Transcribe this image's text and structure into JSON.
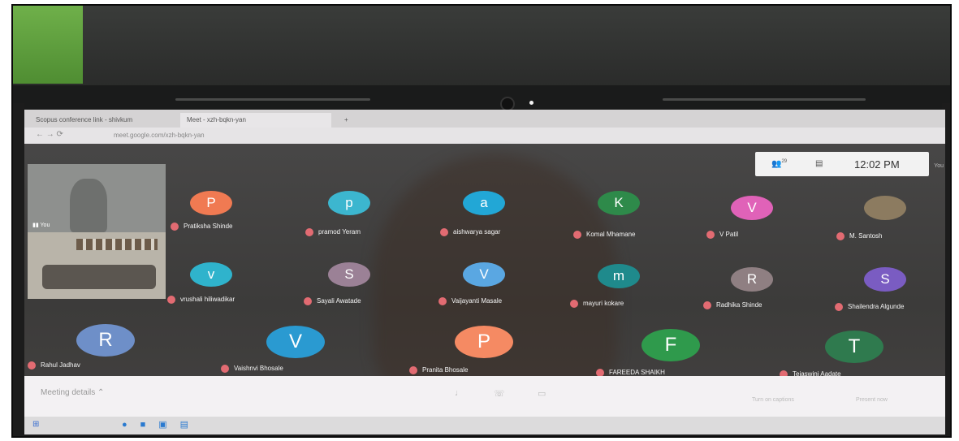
{
  "browser": {
    "tabs": [
      {
        "label": "Scopus conference link - shivkum",
        "active": false
      },
      {
        "label": "Meet - xzh-bqkn-yan",
        "active": true
      }
    ],
    "new_tab": "+",
    "url": "meet.google.com/xzh-bqkn-yan"
  },
  "meet": {
    "clock": {
      "participants_badge": "29",
      "time": "12:02 PM",
      "you_label": "You"
    },
    "self_tile": {
      "label": "You"
    },
    "class_tile": {
      "label": "M. Santosh"
    },
    "participants": [
      {
        "initial": "P",
        "name": "Pratiksha Shinde",
        "color": "#f07a52"
      },
      {
        "initial": "p",
        "name": "pramod Yeram",
        "color": "#3cb6cf"
      },
      {
        "initial": "a",
        "name": "aishwarya sagar",
        "color": "#22a7d6"
      },
      {
        "initial": "K",
        "name": "Komal Mhamane",
        "color": "#2e8a4a"
      },
      {
        "initial": "V",
        "name": "V Patil",
        "color": "#e062b8"
      },
      {
        "initial": "",
        "name": "M. Santosh",
        "color": "#8c7b60"
      },
      {
        "initial": "v",
        "name": "vrushali hiliwadikar",
        "color": "#2fb3cc"
      },
      {
        "initial": "S",
        "name": "Sayali Awatade",
        "color": "#9b8196"
      },
      {
        "initial": "V",
        "name": "Vaijayanti Masale",
        "color": "#5aa7e2"
      },
      {
        "initial": "m",
        "name": "mayuri kokare",
        "color": "#1f8a8c"
      },
      {
        "initial": "R",
        "name": "Radhika Shinde",
        "color": "#8f7f82"
      },
      {
        "initial": "S",
        "name": "Shailendra Algunde",
        "color": "#7a5cc2"
      },
      {
        "initial": "R",
        "name": "Rahul Jadhav",
        "color": "#6e8fc8"
      },
      {
        "initial": "V",
        "name": "Vaishnvi Bhosale",
        "color": "#2a9ad1"
      },
      {
        "initial": "P",
        "name": "Pranita Bhosale",
        "color": "#f58a63"
      },
      {
        "initial": "F",
        "name": "FAREEDA SHAIKH",
        "color": "#2f9a4c"
      },
      {
        "initial": "T",
        "name": "Tejaswini Aadate",
        "color": "#2f7a4e"
      }
    ],
    "bottom_bar": {
      "meeting_details": "Meeting details",
      "captions": "Turn on captions",
      "present": "Present now"
    }
  }
}
